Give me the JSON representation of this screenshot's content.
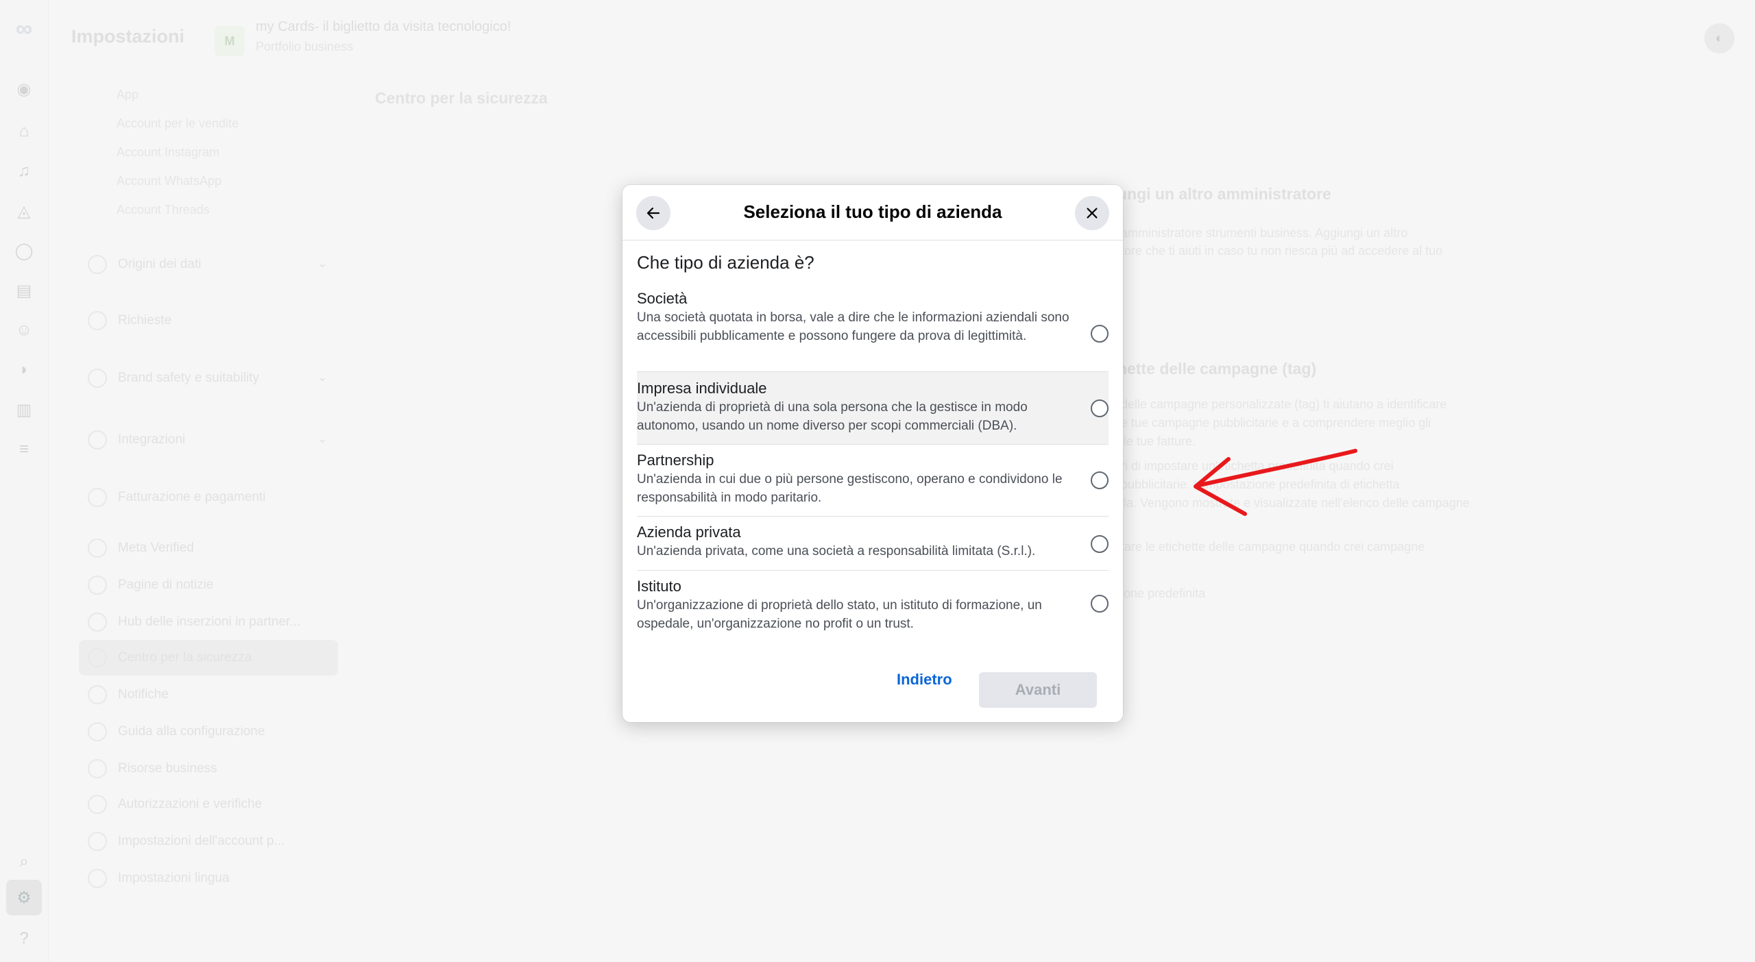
{
  "app": {
    "title": "Impostazioni",
    "business_name": "my Cards- il biglietto da visita tecnologico!",
    "business_sub": "Portfolio business",
    "business_initials": "M"
  },
  "sidebar": {
    "sub_items": [
      "App",
      "Account per le vendite",
      "Account Instagram",
      "Account WhatsApp",
      "Account Threads"
    ],
    "items": [
      {
        "label": "Origini dei dati",
        "expandable": true
      },
      {
        "label": "Richieste",
        "expandable": false
      },
      {
        "label": "Brand safety e suitability",
        "expandable": true
      },
      {
        "label": "Integrazioni",
        "expandable": true
      },
      {
        "label": "Fatturazione e pagamenti",
        "expandable": false
      },
      {
        "label": "Meta Verified",
        "expandable": false
      },
      {
        "label": "Pagine di notizie",
        "expandable": false
      },
      {
        "label": "Hub delle inserzioni in partner...",
        "expandable": false
      },
      {
        "label": "Centro per la sicurezza",
        "expandable": false,
        "selected": true
      },
      {
        "label": "Notifiche",
        "expandable": false
      },
      {
        "label": "Guida alla configurazione",
        "expandable": false
      },
      {
        "label": "Risorse business",
        "expandable": false
      },
      {
        "label": "Autorizzazioni e verifiche",
        "expandable": false
      },
      {
        "label": "Impostazioni dell'account p...",
        "expandable": false
      },
      {
        "label": "Impostazioni lingua",
        "expandable": false
      }
    ]
  },
  "main": {
    "page_title": "Centro per la sicurezza",
    "bg_heading_1": "ungi un altro amministratore",
    "bg_line_1": "amministratore strumenti business. Aggiungi un altro",
    "bg_line_2": "tore che ti aiuti in caso tu non riesca più ad accedere al tuo",
    "bg_heading_2": "hette delle campagne (tag)",
    "bg_line_3": "delle campagne personalizzate (tag) ti aiutano a identificare",
    "bg_line_4": "e tue campagne pubblicitarie e a comprendere meglio gli",
    "bg_line_5": "lle tue fatture.",
    "bg_line_6": "ri di impostare un'etichetta predefinita quando crei",
    "bg_line_7": "pubblicitarie. L'impostazione predefinita di etichetta",
    "bg_line_8": "lla. Vengono mostrate e visualizzate nell'elenco delle campagne",
    "bg_line_9": "tare le etichette delle campagne quando crei campagne",
    "bg_line_10": "ione predefinita"
  },
  "modal": {
    "title": "Seleziona il tuo tipo di azienda",
    "question": "Che tipo di azienda è?",
    "options": [
      {
        "title": "Società",
        "description": "Una società quotata in borsa, vale a dire che le informazioni aziendali sono accessibili pubblicamente e possono fungere da prova di legittimità."
      },
      {
        "title": "Impresa individuale",
        "description": "Un'azienda di proprietà di una sola persona che la gestisce in modo autonomo, usando un nome diverso per scopi commerciali (DBA)."
      },
      {
        "title": "Partnership",
        "description": "Un'azienda in cui due o più persone gestiscono, operano e condividono le responsabilità in modo paritario."
      },
      {
        "title": "Azienda privata",
        "description": "Un'azienda privata, come una società a responsabilità limitata (S.r.l.)."
      },
      {
        "title": "Istituto",
        "description": "Un'organizzazione di proprietà dello stato, un istituto di formazione, un ospedale, un'organizzazione no profit o un trust."
      }
    ],
    "back_label": "Indietro",
    "next_label": "Avanti"
  },
  "colors": {
    "link_blue": "#0b66d6",
    "annotation_arrow": "#e8191c",
    "hover_row": "#f2f2f2"
  },
  "icons": {
    "back": "arrow-left-icon",
    "close": "close-icon",
    "annotation": "red-arrow-annotation"
  }
}
